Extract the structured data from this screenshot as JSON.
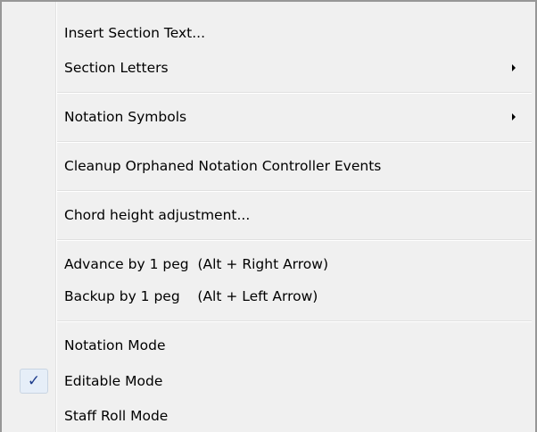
{
  "menu": {
    "items": [
      {
        "label": "Insert Section Text..."
      },
      {
        "label": "Section Letters",
        "submenu": true
      },
      {
        "label": "Notation Symbols",
        "submenu": true
      },
      {
        "label": "Cleanup Orphaned Notation Controller Events"
      },
      {
        "label": "Chord height adjustment..."
      },
      {
        "label": "Advance by 1 peg",
        "shortcut": "(Alt + Right Arrow)"
      },
      {
        "label": "Backup by 1 peg",
        "shortcut": "(Alt + Left Arrow)"
      },
      {
        "label": "Notation Mode"
      },
      {
        "label": "Editable Mode",
        "checked": true,
        "check_glyph": "✓"
      },
      {
        "label": "Staff Roll Mode"
      }
    ]
  }
}
